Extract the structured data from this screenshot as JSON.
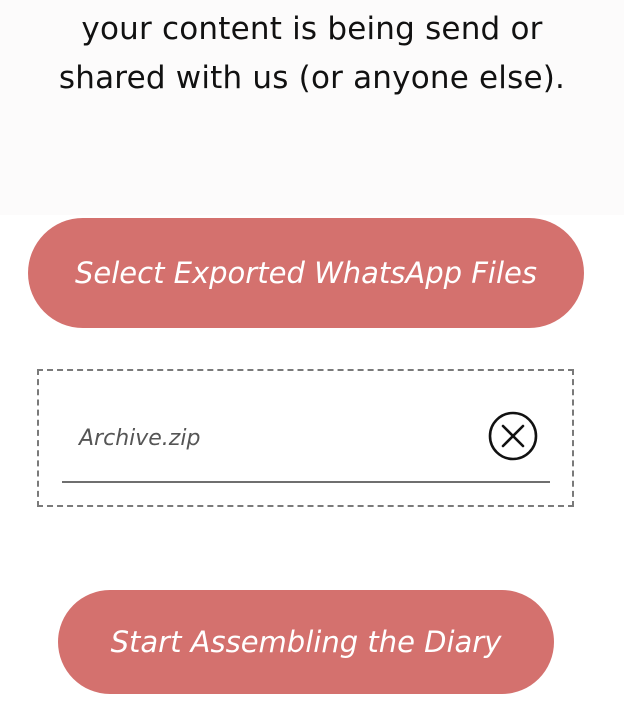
{
  "intro": {
    "line1": "your content is being send or",
    "line2": "shared with us (or anyone else)."
  },
  "buttons": {
    "select_label": "Select Exported WhatsApp Files",
    "start_label": "Start Assembling the Diary"
  },
  "file": {
    "name": "Archive.zip",
    "remove_icon": "close-circle-icon"
  },
  "colors": {
    "accent": "#d4716e",
    "text": "#111111",
    "file_text": "#555555"
  }
}
